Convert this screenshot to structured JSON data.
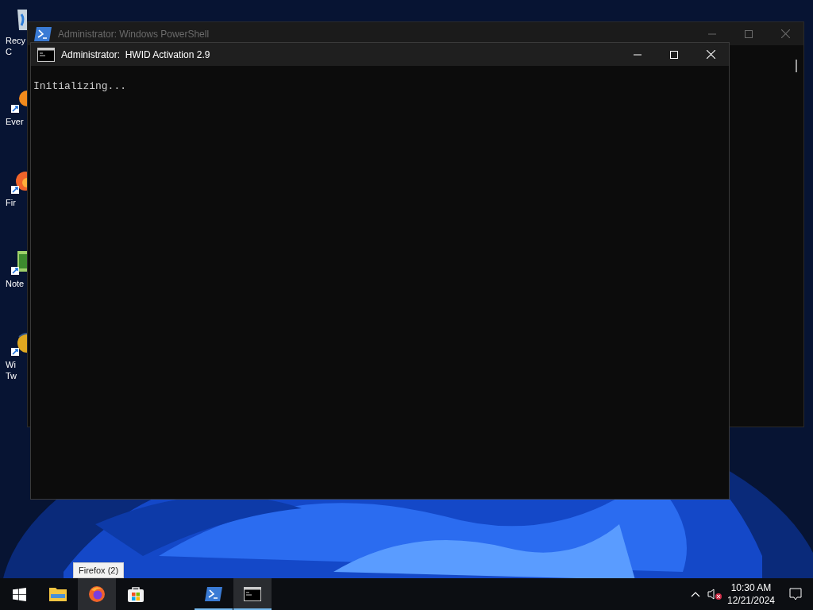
{
  "desktop": {
    "icons": [
      {
        "kind": "bin",
        "lines": [
          "Recy",
          "C"
        ]
      },
      {
        "kind": "app",
        "lines": [
          "Ever"
        ]
      },
      {
        "kind": "fox",
        "lines": [
          "Fir"
        ]
      },
      {
        "kind": "notepad",
        "lines": [
          "Note"
        ]
      },
      {
        "kind": "globe",
        "lines": [
          "Wi",
          "Tw"
        ]
      }
    ]
  },
  "windows": [
    {
      "title": "Administrator: Windows PowerShell",
      "kind": "powershell",
      "active": false
    },
    {
      "title": "Administrator:  HWID Activation 2.9",
      "kind": "cmd",
      "active": true,
      "console": [
        "Initializing..."
      ]
    }
  ],
  "taskbar": {
    "items": [
      {
        "kind": "start",
        "running": false,
        "selected": false
      },
      {
        "kind": "explorer",
        "running": false,
        "selected": false
      },
      {
        "kind": "firefox",
        "running": false,
        "selected": true
      },
      {
        "kind": "store",
        "running": false,
        "selected": false
      },
      {
        "kind": "powershell",
        "running": true,
        "selected": false
      },
      {
        "kind": "cmd",
        "running": true,
        "selected": true
      }
    ],
    "tooltip": "Firefox (2)",
    "volume_muted": true,
    "clock": {
      "time": "10:30 AM",
      "date": "12/21/2024"
    }
  }
}
